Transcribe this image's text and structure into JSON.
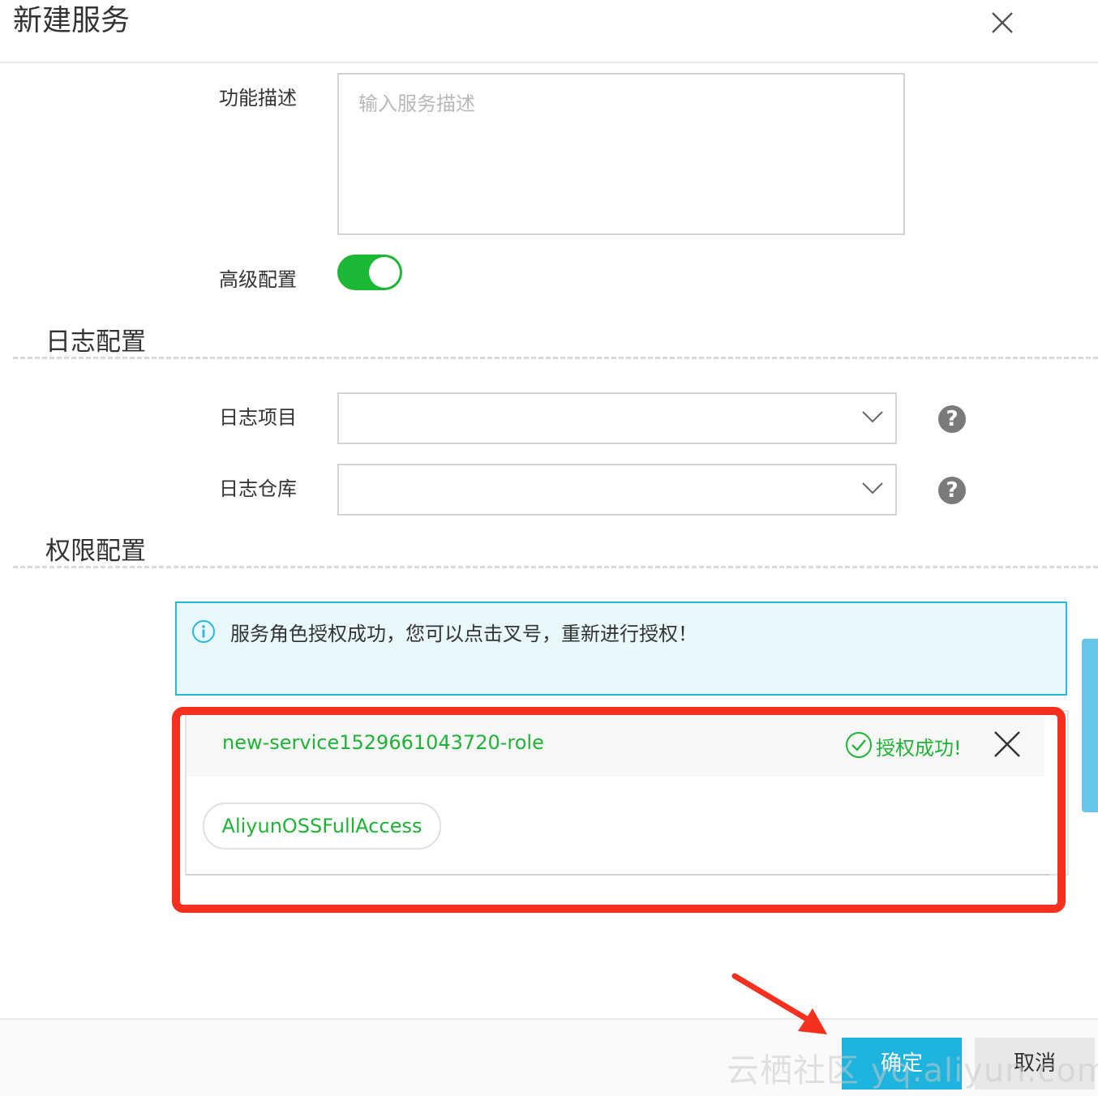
{
  "dialog": {
    "title": "新建服务"
  },
  "form": {
    "description_label": "功能描述",
    "description_placeholder": "输入服务描述",
    "description_value": "",
    "advanced_label": "高级配置",
    "advanced_enabled": true
  },
  "log_section": {
    "title": "日志配置",
    "project_label": "日志项目",
    "project_value": "",
    "store_label": "日志仓库",
    "store_value": "",
    "help_glyph": "?"
  },
  "permission_section": {
    "title": "权限配置",
    "alert_message": "服务角色授权成功，您可以点击叉号，重新进行授权！",
    "role_name": "new-service1529661043720-role",
    "auth_status": "授权成功!",
    "policy": "AliyunOSSFullAccess"
  },
  "footer": {
    "confirm_label": "确定",
    "cancel_label": "取消",
    "watermark": "云栖社区 yq.aliyun.com"
  },
  "colors": {
    "accent": "#1fb4dd",
    "success": "#1fb336",
    "highlight": "#f5301e",
    "toggle_on": "#1db736"
  },
  "icons": [
    "close-icon",
    "chevron-down-icon",
    "help-icon",
    "info-icon",
    "check-circle-icon",
    "arrow-annotation"
  ]
}
